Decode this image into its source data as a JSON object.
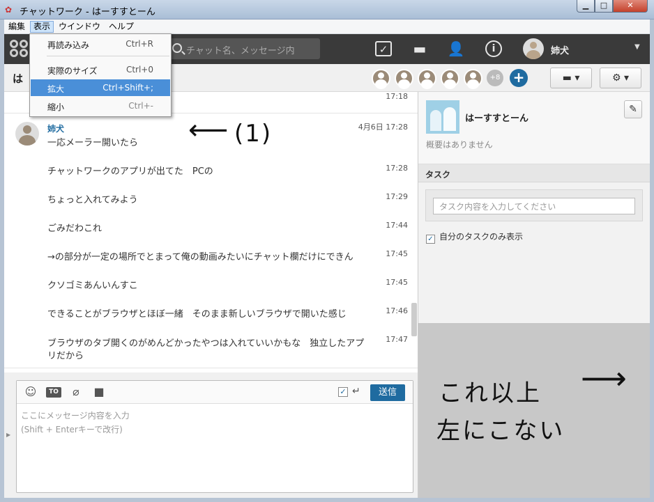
{
  "window": {
    "title": "チャットワーク - はーすすとーん",
    "min": "▁",
    "max": "□",
    "close": "✕"
  },
  "menubar": [
    "編集",
    "表示",
    "ウインドウ",
    "ヘルプ"
  ],
  "dropdown": {
    "items": [
      {
        "label": "再読み込み",
        "shortcut": "Ctrl+R"
      },
      {
        "label": "実際のサイズ",
        "shortcut": "Ctrl+0"
      },
      {
        "label": "拡大",
        "shortcut": "Ctrl+Shift+;"
      },
      {
        "label": "縮小",
        "shortcut": "Ctrl+-"
      }
    ]
  },
  "header": {
    "search_placeholder": "チャット名、メッセージ内",
    "username": "姉犬",
    "icons": [
      "task-icon",
      "folder-icon",
      "add-contact-icon",
      "info-icon"
    ]
  },
  "room": {
    "title": "は",
    "members_more": "+8",
    "add": "+"
  },
  "chat": {
    "top_time": "17:18",
    "sender": "姉犬",
    "messages": [
      {
        "text": "一応メーラー開いたら",
        "time": "4月6日 17:28"
      },
      {
        "text": "チャットワークのアプリが出てた　PCの",
        "time": "17:28"
      },
      {
        "text": "ちょっと入れてみよう",
        "time": "17:29"
      },
      {
        "text": "ごみだわこれ",
        "time": "17:44"
      },
      {
        "text": "→の部分が一定の場所でとまって俺の動画みたいにチャット欄だけにできん",
        "time": "17:45"
      },
      {
        "text": "クソゴミあんいんすこ",
        "time": "17:45"
      },
      {
        "text": "できることがブラウザとほぼ一緒　そのまま新しいブラウザで開いた感じ",
        "time": "17:46"
      },
      {
        "text": "ブラウザのタブ開くのがめんどかったやつは入れていいかもな　独立したアプ",
        "text2": "リだから",
        "time": "17:47"
      }
    ]
  },
  "composer": {
    "send_label": "送信",
    "placeholder1": "ここにメッセージ内容を入力",
    "placeholder2": "(Shift + Enterキーで改行)",
    "to_label": "TO"
  },
  "right": {
    "room_name": "はーすすとーん",
    "room_desc": "概要はありません",
    "task_title": "タスク",
    "task_placeholder": "タスク内容を入力してください",
    "mytask_label": "自分のタスクのみ表示"
  },
  "annotations": {
    "label1": "(1)",
    "note_line1": "これ以上",
    "note_line2": "左にこない",
    "arrow_left": "⟵",
    "arrow_right": "⟶"
  }
}
